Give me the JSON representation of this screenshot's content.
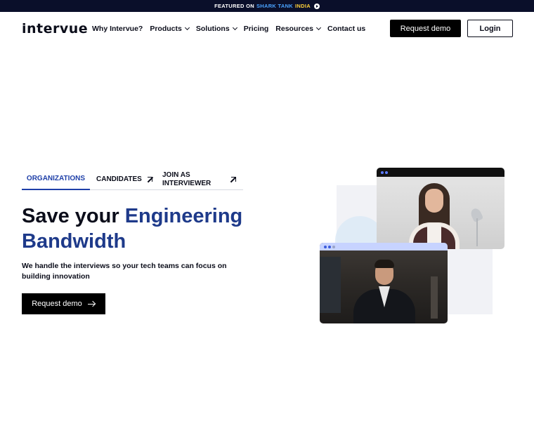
{
  "banner": {
    "prefix": "FEATURED ON",
    "brand_a": "SHARK TANK",
    "brand_b": "INDIA",
    "play_icon": "play-circle-icon"
  },
  "nav": {
    "logo": "intervue",
    "links": [
      {
        "label": "Why Intervue?",
        "has_dropdown": false
      },
      {
        "label": "Products",
        "has_dropdown": true
      },
      {
        "label": "Solutions",
        "has_dropdown": true
      },
      {
        "label": "Pricing",
        "has_dropdown": false
      },
      {
        "label": "Resources",
        "has_dropdown": true
      },
      {
        "label": "Contact us",
        "has_dropdown": false
      }
    ],
    "request_demo": "Request demo",
    "login": "Login"
  },
  "tabs": [
    {
      "label": "ORGANIZATIONS",
      "active": true
    },
    {
      "label": "CANDIDATES",
      "icon": "external-arrow-icon"
    },
    {
      "label": "JOIN AS INTERVIEWER",
      "icon": "external-arrow-icon"
    }
  ],
  "hero": {
    "title_plain": "Save your ",
    "title_accent": "Engineering Bandwidth",
    "subtitle": "We handle the interviews so your tech teams can focus on building innovation",
    "cta": "Request demo"
  },
  "colors": {
    "accent": "#1e3a8a",
    "banner_bg": "#0a0f2a",
    "button_bg": "#000000"
  }
}
